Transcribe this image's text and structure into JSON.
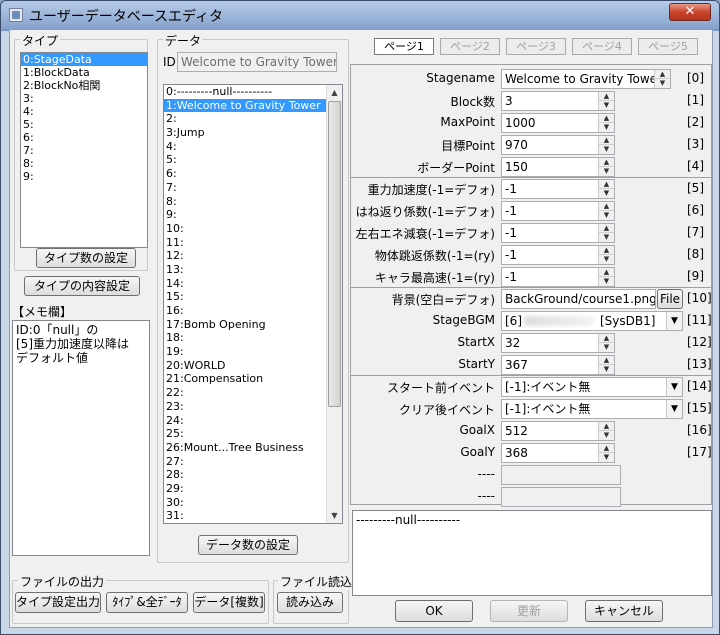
{
  "window": {
    "title": "ユーザーデータベースエディタ",
    "close_label": "✕"
  },
  "type_group": {
    "label": "タイプ",
    "items": [
      "0:StageData",
      "1:BlockData",
      "2:BlockNo相関",
      "3:",
      "4:",
      "5:",
      "6:",
      "7:",
      "8:",
      "9:"
    ],
    "selected_index": 0,
    "count_button": "タイプ数の設定",
    "content_button": "タイプの内容設定"
  },
  "memo": {
    "label": "【メモ欄】",
    "text": "ID:0「null」の\n[5]重力加速度以降は\nデフォルト値"
  },
  "data_group": {
    "label": "データ",
    "id_label": "ID",
    "id_value": "Welcome to Gravity Tower",
    "items": [
      "0:---------null----------",
      "1:Welcome to Gravity Tower",
      "2:",
      "3:Jump",
      "4:",
      "5:",
      "6:",
      "7:",
      "8:",
      "9:",
      "10:",
      "11:",
      "12:",
      "13:",
      "14:",
      "15:",
      "16:",
      "17:Bomb Opening",
      "18:",
      "19:",
      "20:WORLD",
      "21:Compensation",
      "22:",
      "23:",
      "24:",
      "25:",
      "26:Mount...Tree Business",
      "27:",
      "28:",
      "29:",
      "30:",
      "31:"
    ],
    "selected_index": 1,
    "count_button": "データ数の設定"
  },
  "tabs": [
    {
      "label": "ページ1",
      "active": true
    },
    {
      "label": "ページ2",
      "active": false
    },
    {
      "label": "ページ3",
      "active": false
    },
    {
      "label": "ページ4",
      "active": false
    },
    {
      "label": "ページ5",
      "active": false
    }
  ],
  "fields": [
    {
      "label": "Stagename",
      "value": "Welcome to Gravity Tower",
      "index": "[0]",
      "kind": "text"
    },
    {
      "label": "Block数",
      "value": "3",
      "index": "[1]",
      "kind": "spin"
    },
    {
      "label": "MaxPoint",
      "value": "1000",
      "index": "[2]",
      "kind": "spin"
    },
    {
      "label": "目標Point",
      "value": "970",
      "index": "[3]",
      "kind": "spin"
    },
    {
      "label": "ボーダーPoint",
      "value": "150",
      "index": "[4]",
      "kind": "spin"
    },
    {
      "label": "重力加速度(-1=デフォ)",
      "value": "-1",
      "index": "[5]",
      "kind": "spin"
    },
    {
      "label": "はね返り係数(-1=デフォ)",
      "value": "-1",
      "index": "[6]",
      "kind": "spin"
    },
    {
      "label": "左右エネ減衰(-1=デフォ)",
      "value": "-1",
      "index": "[7]",
      "kind": "spin"
    },
    {
      "label": "物体跳返係数(-1=(ry)",
      "value": "-1",
      "index": "[8]",
      "kind": "spin"
    },
    {
      "label": "キャラ最高速(-1=(ry)",
      "value": "-1",
      "index": "[9]",
      "kind": "spin"
    },
    {
      "label": "背景(空白=デフォ)",
      "value": "BackGround/course1.png",
      "index": "[10]",
      "kind": "file",
      "button": "File"
    },
    {
      "label": "StageBGM",
      "value": "[6]",
      "index": "[11]",
      "kind": "dropdown",
      "suffix": "[SysDB1]"
    },
    {
      "label": "StartX",
      "value": "32",
      "index": "[12]",
      "kind": "spin"
    },
    {
      "label": "StartY",
      "value": "367",
      "index": "[13]",
      "kind": "spin"
    },
    {
      "label": "スタート前イベント",
      "value": "[-1]:イベント無",
      "index": "[14]",
      "kind": "dropdown"
    },
    {
      "label": "クリア後イベント",
      "value": "[-1]:イベント無",
      "index": "[15]",
      "kind": "dropdown"
    },
    {
      "label": "GoalX",
      "value": "512",
      "index": "[16]",
      "kind": "spin"
    },
    {
      "label": "GoalY",
      "value": "368",
      "index": "[17]",
      "kind": "spin"
    },
    {
      "label": "----",
      "value": "",
      "index": "",
      "kind": "empty"
    },
    {
      "label": "----",
      "value": "",
      "index": "",
      "kind": "empty"
    }
  ],
  "bottom_memo": "---------null----------",
  "file_output": {
    "label": "ファイルの出力",
    "buttons": [
      "タイプ設定出力",
      "ﾀｲﾌﾟ&全ﾃﾞｰﾀ",
      "データ[複数]"
    ]
  },
  "file_read": {
    "label": "ファイル読込",
    "button": "読み込み"
  },
  "dialog_buttons": {
    "ok": "OK",
    "update": "更新",
    "cancel": "キャンセル"
  }
}
